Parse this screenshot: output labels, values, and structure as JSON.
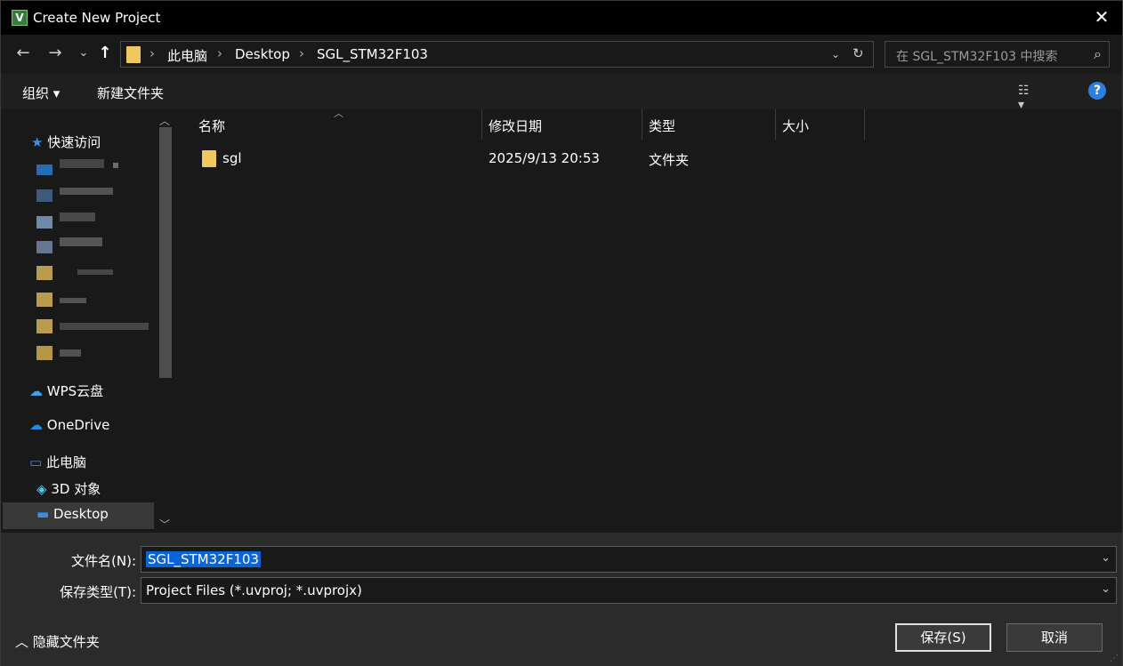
{
  "window": {
    "title": "Create New Project",
    "app_icon_letter": "V"
  },
  "nav": {
    "back": "←",
    "forward": "→",
    "recent": "⌄",
    "up": "↑",
    "breadcrumbs": [
      "此电脑",
      "Desktop",
      "SGL_STM32F103"
    ],
    "search_placeholder": "在 SGL_STM32F103 中搜索"
  },
  "toolbar": {
    "organize": "组织 ▾",
    "new_folder": "新建文件夹"
  },
  "sidebar": {
    "quick_access": "快速访问",
    "wps": "WPS云盘",
    "onedrive": "OneDrive",
    "this_pc": "此电脑",
    "objects_3d": "3D 对象",
    "desktop": "Desktop"
  },
  "columns": [
    "名称",
    "修改日期",
    "类型",
    "大小"
  ],
  "files": [
    {
      "name": "sgl",
      "modified": "2025/9/13 20:53",
      "type": "文件夹",
      "size": ""
    }
  ],
  "form": {
    "filename_label": "文件名(N):",
    "filename_value": "SGL_STM32F103",
    "filetype_label": "保存类型(T):",
    "filetype_value": "Project Files (*.uvproj; *.uvprojx)"
  },
  "buttons": {
    "save": "保存(S)",
    "cancel": "取消",
    "hide_folders": "隐藏文件夹"
  },
  "colors": {
    "accent": "#0a64d6",
    "folder": "#f0c860",
    "background": "#191919"
  }
}
